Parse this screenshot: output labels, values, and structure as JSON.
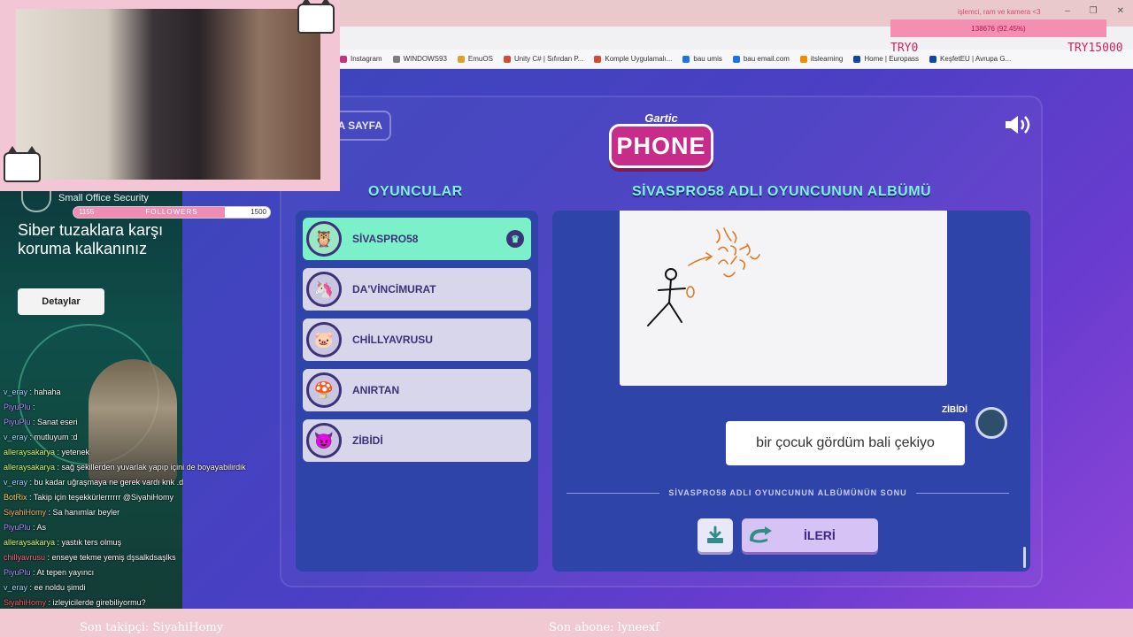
{
  "system_overlay": {
    "title": "işlemci, ram ve kamera <3",
    "cpu_value": "138676 (92.45%)",
    "try_left": "TRY0",
    "try_right": "TRY15000"
  },
  "window_controls": [
    "–",
    "❐",
    "✕"
  ],
  "bookmarks": [
    {
      "label": "Instagram",
      "color": "#c13584"
    },
    {
      "label": "WINDOWS93",
      "color": "#7d7d7d"
    },
    {
      "label": "EmuOS",
      "color": "#e0a12a"
    },
    {
      "label": "Unity C# | Sıfırdan P...",
      "color": "#d24b35"
    },
    {
      "label": "Komple Uygulamalı...",
      "color": "#d24b35"
    },
    {
      "label": "bau umis",
      "color": "#1a73e8"
    },
    {
      "label": "bau email.com",
      "color": "#1a73e8"
    },
    {
      "label": "itslearning",
      "color": "#f08c00"
    },
    {
      "label": "Home | Europass",
      "color": "#0e47a1"
    },
    {
      "label": "KeşfetEU | Avrupa G...",
      "color": "#0e47a1"
    }
  ],
  "game": {
    "home_label": "A SAYFA",
    "logo_small": "Gartic",
    "logo_big": "PHONE",
    "players_title": "OYUNCULAR",
    "album_title": "SİVASPRO58 ADLI OYUNCUNUN ALBÜMÜ",
    "players": [
      {
        "name": "SİVASPRO58",
        "avatar": "🦉",
        "active": true,
        "host": true
      },
      {
        "name": "DA'VİNCİMURAT",
        "avatar": "🦄",
        "active": false,
        "host": false
      },
      {
        "name": "CHİLLYAVRUSU",
        "avatar": "🐷",
        "active": false,
        "host": false
      },
      {
        "name": "ANIRTAN",
        "avatar": "🍄",
        "active": false,
        "host": false
      },
      {
        "name": "ZİBİDİ",
        "avatar": "😈",
        "active": false,
        "host": false
      }
    ],
    "guess_author": "ZİBİDİ",
    "guess_text": "bir çocuk gördüm bali çekiyo",
    "album_end_text": "SİVASPRO58 ADLI OYUNCUNUN ALBÜMÜNÜN SONU",
    "next_label": "İLERİ"
  },
  "ad": {
    "brand": "Small Office Security",
    "headline": "Siber tuzaklara karşı koruma kalkanınız",
    "cta": "Detaylar"
  },
  "followers": {
    "low": "1155",
    "label": "FOLLOWERS",
    "high": "1500",
    "progress": 0.77
  },
  "chat": [
    {
      "user": "v_eray",
      "text": ": hahaha",
      "color": "#9fd8ff"
    },
    {
      "user": "PiyuPlu",
      "text": ":",
      "color": "#b18cff"
    },
    {
      "user": "PiyuPlu",
      "text": ": Sanat eseri",
      "color": "#b18cff"
    },
    {
      "user": "v_eray",
      "text": ": mutluyum :d",
      "color": "#9fd8ff"
    },
    {
      "user": "alleraysakarya",
      "text": ": yetenek",
      "color": "#d5ff7a"
    },
    {
      "user": "alleraysakarya",
      "text": ": sağ şekillerden yuvarlak yapıp içini de boyayabilirdik",
      "color": "#d5ff7a"
    },
    {
      "user": "v_eray",
      "text": ": bu kadar uğraşmaya ne gerek vardı knk .d",
      "color": "#9fd8ff"
    },
    {
      "user": "BotRix",
      "text": ": Takip için teşekkürlerrrrrr @SiyahiHomy",
      "color": "#ffd36b"
    },
    {
      "user": "SiyahiHomy",
      "text": ": Sa hanımlar beyler",
      "color": "#ffb36b"
    },
    {
      "user": "PiyuPlu",
      "text": ": As",
      "color": "#b18cff"
    },
    {
      "user": "alleraysakarya",
      "text": ": yastık ters olmuş",
      "color": "#d5ff7a"
    },
    {
      "user": "chillyavrusu",
      "text": ": enseye tekme yemiş dşsalkdsaşlks",
      "color": "#ff6a8a"
    },
    {
      "user": "PiyuPlu",
      "text": ": At tepen yayıncı",
      "color": "#b18cff"
    },
    {
      "user": "v_eray",
      "text": ": ee noldu şimdi",
      "color": "#9fd8ff"
    },
    {
      "user": "SiyahiHomy",
      "text": ": izleyicilerde girebiliyormu?",
      "color": "#ff5a6a"
    }
  ],
  "bottom": {
    "last_follower": "Son takipçi: SiyahiHomy",
    "last_sub": "Son abone: lyneexf"
  }
}
